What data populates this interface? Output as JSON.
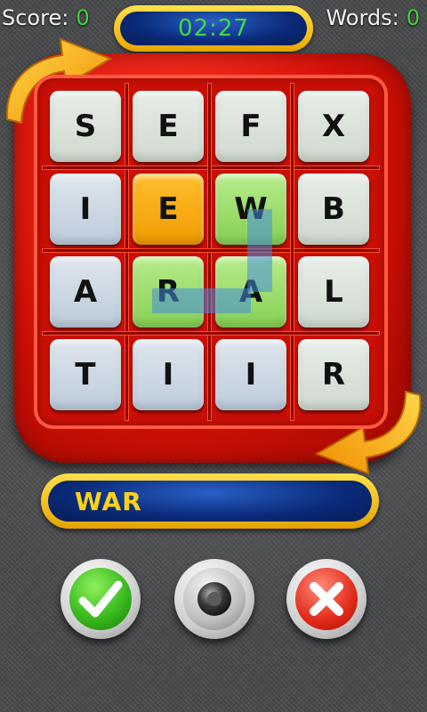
{
  "hud": {
    "score_label": "Score:",
    "score_value": "0",
    "words_label": "Words:",
    "words_value": "0",
    "timer": "02:27"
  },
  "board": {
    "rows": [
      [
        "S",
        "E",
        "F",
        "X"
      ],
      [
        "I",
        "E",
        "W",
        "B"
      ],
      [
        "A",
        "R",
        "A",
        "L"
      ],
      [
        "T",
        "I",
        "I",
        "R"
      ]
    ],
    "tile_styles": [
      [
        "light",
        "light",
        "light",
        "light"
      ],
      [
        "blue",
        "orange",
        "green",
        "light"
      ],
      [
        "blue",
        "green",
        "green",
        "light"
      ],
      [
        "blue",
        "blue",
        "blue",
        "light"
      ]
    ],
    "selected_path": [
      [
        1,
        2
      ],
      [
        2,
        2
      ],
      [
        2,
        1
      ]
    ]
  },
  "current_word": "WAR",
  "buttons": {
    "accept_icon": "checkmark-icon",
    "sound_icon": "speaker-icon",
    "cancel_icon": "x-icon"
  },
  "colors": {
    "accent_green": "#3fd23f",
    "word_yellow": "#ffd21a",
    "board_red": "#d31108",
    "pill_blue": "#0a2a78"
  }
}
